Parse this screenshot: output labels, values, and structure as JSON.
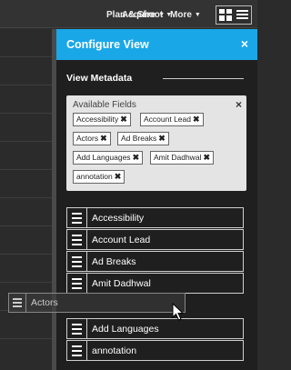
{
  "nav": {
    "plan_shoot": "Plan & Shoot",
    "acquire": "Acquire",
    "more": "More"
  },
  "panel": {
    "title": "Configure View",
    "close": "×",
    "section_title": "View Metadata"
  },
  "available_fields": {
    "label": "Available Fields",
    "close": "×",
    "chips": [
      "Accessibility",
      "Account Lead",
      "Actors",
      "Ad Breaks",
      "Add Languages",
      "Amit Dadhwal",
      "annotation"
    ],
    "chip_remove": "✖"
  },
  "fields_group_1": [
    "Accessibility",
    "Account Lead",
    "Ad Breaks",
    "Amit Dadhwal"
  ],
  "fields_group_2": [
    "Add Languages",
    "annotation"
  ],
  "dragging": {
    "label": "Actors"
  },
  "colors": {
    "accent": "#1aa7e8",
    "panel_bg": "#1f1f1f",
    "chip_bg": "#ffffff",
    "box_bg": "#e4e4e4"
  }
}
